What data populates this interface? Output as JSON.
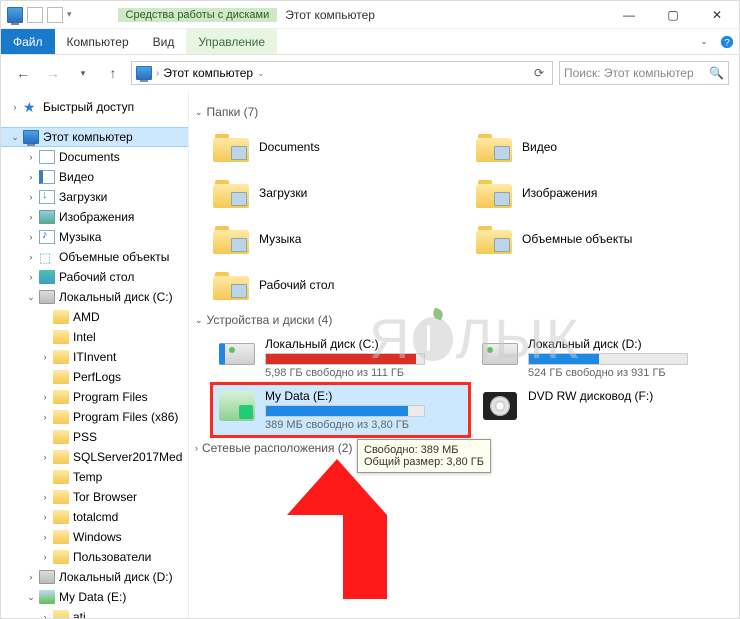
{
  "titlebar": {
    "context_label": "Средства работы с дисками",
    "title": "Этот компьютер"
  },
  "ribbon": {
    "file": "Файл",
    "computer": "Компьютер",
    "view": "Вид",
    "ctx": "Управление"
  },
  "addr": {
    "location": "Этот компьютер"
  },
  "search": {
    "placeholder": "Поиск: Этот компьютер"
  },
  "sidebar": {
    "quick": "Быстрый доступ",
    "this_pc": "Этот компьютер",
    "lib": [
      "Documents",
      "Видео",
      "Загрузки",
      "Изображения",
      "Музыка",
      "Объемные объекты",
      "Рабочий стол"
    ],
    "cdrive": "Локальный диск (C:)",
    "cfolders": [
      "AMD",
      "Intel",
      "ITInvent",
      "PerfLogs",
      "Program Files",
      "Program Files (x86)",
      "PSS",
      "SQLServer2017Med",
      "Temp",
      "Tor Browser",
      "totalcmd",
      "Windows",
      "Пользователи"
    ],
    "ddrive": "Локальный диск (D:)",
    "edrive": "My Data (E:)",
    "e_sub": "ati"
  },
  "groups": {
    "folders": "Папки (7)",
    "drives": "Устройства и диски (4)",
    "net": "Сетевые расположения (2)"
  },
  "folders": [
    {
      "name": "Documents",
      "type": "doc"
    },
    {
      "name": "Видео",
      "type": "vid"
    },
    {
      "name": "Загрузки",
      "type": "dl"
    },
    {
      "name": "Изображения",
      "type": "img"
    },
    {
      "name": "Музыка",
      "type": "mus"
    },
    {
      "name": "Объемные объекты",
      "type": "cube"
    },
    {
      "name": "Рабочий стол",
      "type": "desk"
    }
  ],
  "drives": {
    "c": {
      "name": "Локальный диск (C:)",
      "sub": "5,98 ГБ свободно из 111 ГБ",
      "pct": 95,
      "color": "red"
    },
    "d": {
      "name": "Локальный диск (D:)",
      "sub": "524 ГБ свободно из 931 ГБ",
      "pct": 44,
      "color": "blue"
    },
    "e": {
      "name": "My Data (E:)",
      "sub": "389 МБ свободно из 3,80 ГБ",
      "pct": 90,
      "color": "blue"
    },
    "dvd": {
      "name": "DVD RW дисковод (F:)"
    }
  },
  "tooltip": {
    "l1": "Свободно: 389 МБ",
    "l2": "Общий размер: 3,80 ГБ"
  },
  "watermark": {
    "a": "Я",
    "b": "ЛЫК"
  }
}
